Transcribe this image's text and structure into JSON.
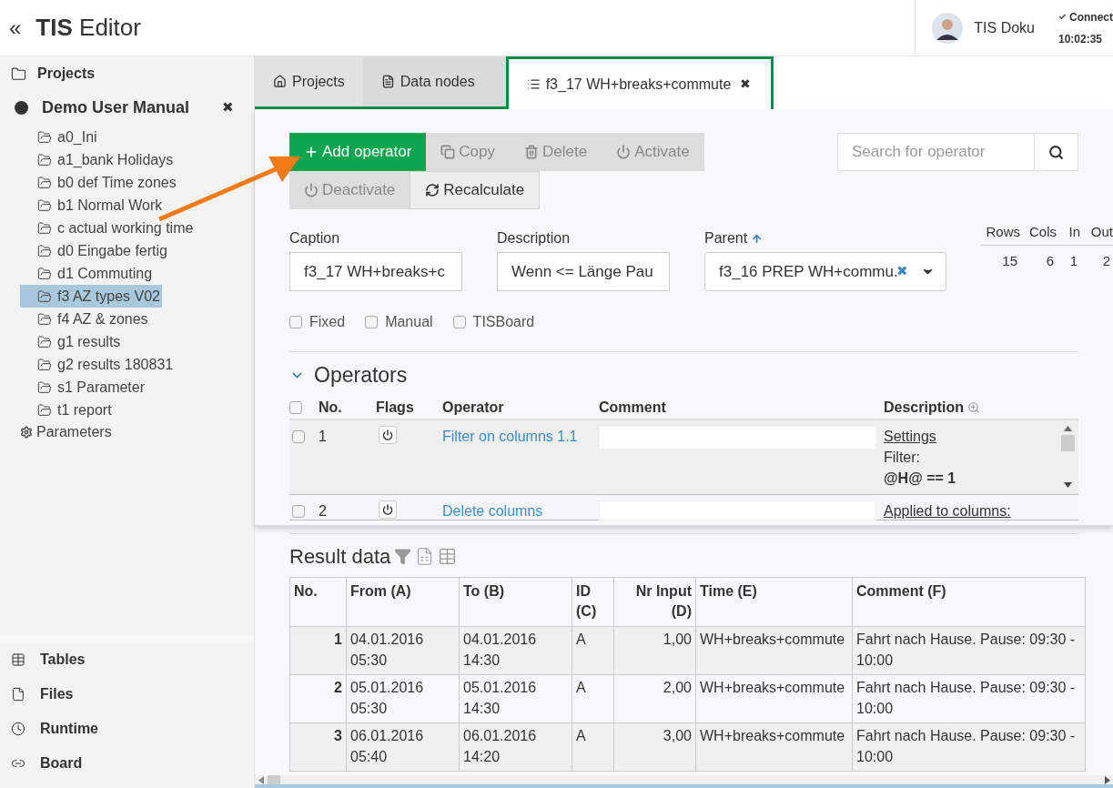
{
  "header": {
    "collapse_icon": "«",
    "title": "**TIS** Editor",
    "user": "TIS Doku",
    "status": "Connect",
    "time": "10:02:35"
  },
  "sidebar": {
    "projects_label": "Projects",
    "project": {
      "name": "Demo User Manual",
      "close": "✖"
    },
    "folders": [
      {
        "label": "a0_Ini",
        "selected": false
      },
      {
        "label": "a1_bank Holidays",
        "selected": false
      },
      {
        "label": "b0 def Time zones",
        "selected": false
      },
      {
        "label": "b1 Normal Work",
        "selected": false
      },
      {
        "label": "c actual working time",
        "selected": false
      },
      {
        "label": "d0 Eingabe fertig",
        "selected": false
      },
      {
        "label": "d1 Commuting",
        "selected": false
      },
      {
        "label": "f3 AZ types V02",
        "selected": true
      },
      {
        "label": "f4 AZ & zones",
        "selected": false
      },
      {
        "label": "g1 results",
        "selected": false
      },
      {
        "label": "g2 results 180831",
        "selected": false
      },
      {
        "label": "s1 Parameter",
        "selected": false
      },
      {
        "label": "t1 report",
        "selected": false
      }
    ],
    "parameters": "Parameters",
    "nav": [
      {
        "label": "Tables",
        "kind": "table"
      },
      {
        "label": "Files",
        "kind": "file"
      },
      {
        "label": "Runtime",
        "kind": "clock"
      },
      {
        "label": "Board",
        "kind": "link"
      }
    ]
  },
  "tabs": [
    {
      "label": "Projects",
      "kind": "home",
      "selected": false
    },
    {
      "label": "Data nodes",
      "kind": "file",
      "selected": false
    },
    {
      "label": "f3_17 WH+breaks+commute",
      "kind": "list",
      "selected": true,
      "close": "✖"
    }
  ],
  "toolbar": [
    {
      "label": "Add operator",
      "kind": "plus",
      "primary": true,
      "disabled": false
    },
    {
      "label": "Copy",
      "kind": "copy",
      "primary": false,
      "disabled": true
    },
    {
      "label": "Delete",
      "kind": "trash",
      "primary": false,
      "disabled": true
    },
    {
      "label": "Activate",
      "kind": "power",
      "primary": false,
      "disabled": true
    },
    {
      "label": "Deactivate",
      "kind": "power",
      "primary": false,
      "disabled": true
    },
    {
      "label": "Recalculate",
      "kind": "refresh",
      "primary": false,
      "disabled": false
    }
  ],
  "search": {
    "placeholder": "Search for operator"
  },
  "fields": {
    "caption": {
      "label": "Caption",
      "value": "f3_17 WH+breaks+c"
    },
    "description": {
      "label": "Description",
      "value": "Wenn <= Länge Pau"
    },
    "parent": {
      "label": "Parent",
      "value": "f3_16 PREP WH+commu.",
      "clear": "✖"
    }
  },
  "stats": {
    "columns": [
      "Rows",
      "Cols",
      "In",
      "Out"
    ],
    "values": [
      "15",
      "6",
      "1",
      "2"
    ]
  },
  "checkboxes": [
    {
      "label": "Fixed",
      "checked": false
    },
    {
      "label": "Manual",
      "checked": false
    },
    {
      "label": "TISBoard",
      "checked": false
    }
  ],
  "operators": {
    "title": "Operators",
    "expanded": true,
    "select_all": {
      "checked": false
    },
    "columns": [
      "No.",
      "Flags",
      "Operator",
      "Comment",
      "Description"
    ],
    "rows": [
      {
        "no": "1",
        "operator": "Filter on columns 1.1",
        "selected": true,
        "checked": false,
        "description": [
          "Settings",
          "Filter:",
          "@H@ == 1"
        ]
      },
      {
        "no": "2",
        "operator": "Delete columns",
        "selected": false,
        "checked": false,
        "description": [
          "Applied to columns:"
        ]
      }
    ]
  },
  "result": {
    "title": "Result data",
    "columns": [
      "No.",
      "From (A)",
      "To (B)",
      "ID (C)",
      "Nr Input (D)",
      "Time (E)",
      "Comment (F)"
    ],
    "rows": [
      [
        "1",
        "04.01.2016 05:30",
        "04.01.2016 14:30",
        "A",
        "1,00",
        "WH+breaks+commute",
        "Fahrt nach Hause. Pause: 09:30 - 10:00"
      ],
      [
        "2",
        "05.01.2016 05:30",
        "05.01.2016 14:30",
        "A",
        "2,00",
        "WH+breaks+commute",
        "Fahrt nach Hause. Pause: 09:30 - 10:00"
      ],
      [
        "3",
        "06.01.2016 05:40",
        "06.01.2016 14:20",
        "A",
        "3,00",
        "WH+breaks+commute",
        "Fahrt nach Hause. Pause: 09:30 - 10:00"
      ]
    ]
  }
}
